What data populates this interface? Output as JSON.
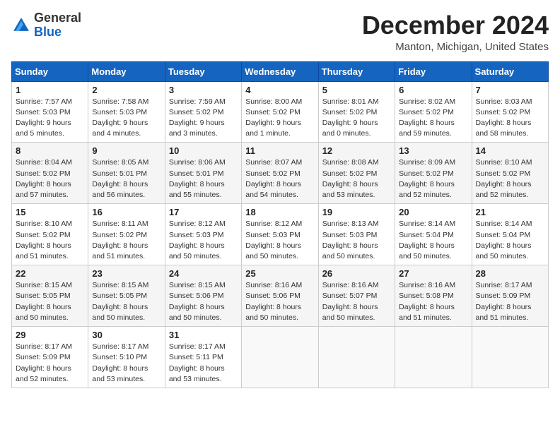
{
  "header": {
    "logo_general": "General",
    "logo_blue": "Blue",
    "month_title": "December 2024",
    "location": "Manton, Michigan, United States"
  },
  "days_of_week": [
    "Sunday",
    "Monday",
    "Tuesday",
    "Wednesday",
    "Thursday",
    "Friday",
    "Saturday"
  ],
  "weeks": [
    [
      {
        "day": 1,
        "sunrise": "Sunrise: 7:57 AM",
        "sunset": "Sunset: 5:03 PM",
        "daylight": "Daylight: 9 hours and 5 minutes."
      },
      {
        "day": 2,
        "sunrise": "Sunrise: 7:58 AM",
        "sunset": "Sunset: 5:03 PM",
        "daylight": "Daylight: 9 hours and 4 minutes."
      },
      {
        "day": 3,
        "sunrise": "Sunrise: 7:59 AM",
        "sunset": "Sunset: 5:02 PM",
        "daylight": "Daylight: 9 hours and 3 minutes."
      },
      {
        "day": 4,
        "sunrise": "Sunrise: 8:00 AM",
        "sunset": "Sunset: 5:02 PM",
        "daylight": "Daylight: 9 hours and 1 minute."
      },
      {
        "day": 5,
        "sunrise": "Sunrise: 8:01 AM",
        "sunset": "Sunset: 5:02 PM",
        "daylight": "Daylight: 9 hours and 0 minutes."
      },
      {
        "day": 6,
        "sunrise": "Sunrise: 8:02 AM",
        "sunset": "Sunset: 5:02 PM",
        "daylight": "Daylight: 8 hours and 59 minutes."
      },
      {
        "day": 7,
        "sunrise": "Sunrise: 8:03 AM",
        "sunset": "Sunset: 5:02 PM",
        "daylight": "Daylight: 8 hours and 58 minutes."
      }
    ],
    [
      {
        "day": 8,
        "sunrise": "Sunrise: 8:04 AM",
        "sunset": "Sunset: 5:02 PM",
        "daylight": "Daylight: 8 hours and 57 minutes."
      },
      {
        "day": 9,
        "sunrise": "Sunrise: 8:05 AM",
        "sunset": "Sunset: 5:01 PM",
        "daylight": "Daylight: 8 hours and 56 minutes."
      },
      {
        "day": 10,
        "sunrise": "Sunrise: 8:06 AM",
        "sunset": "Sunset: 5:01 PM",
        "daylight": "Daylight: 8 hours and 55 minutes."
      },
      {
        "day": 11,
        "sunrise": "Sunrise: 8:07 AM",
        "sunset": "Sunset: 5:02 PM",
        "daylight": "Daylight: 8 hours and 54 minutes."
      },
      {
        "day": 12,
        "sunrise": "Sunrise: 8:08 AM",
        "sunset": "Sunset: 5:02 PM",
        "daylight": "Daylight: 8 hours and 53 minutes."
      },
      {
        "day": 13,
        "sunrise": "Sunrise: 8:09 AM",
        "sunset": "Sunset: 5:02 PM",
        "daylight": "Daylight: 8 hours and 52 minutes."
      },
      {
        "day": 14,
        "sunrise": "Sunrise: 8:10 AM",
        "sunset": "Sunset: 5:02 PM",
        "daylight": "Daylight: 8 hours and 52 minutes."
      }
    ],
    [
      {
        "day": 15,
        "sunrise": "Sunrise: 8:10 AM",
        "sunset": "Sunset: 5:02 PM",
        "daylight": "Daylight: 8 hours and 51 minutes."
      },
      {
        "day": 16,
        "sunrise": "Sunrise: 8:11 AM",
        "sunset": "Sunset: 5:02 PM",
        "daylight": "Daylight: 8 hours and 51 minutes."
      },
      {
        "day": 17,
        "sunrise": "Sunrise: 8:12 AM",
        "sunset": "Sunset: 5:03 PM",
        "daylight": "Daylight: 8 hours and 50 minutes."
      },
      {
        "day": 18,
        "sunrise": "Sunrise: 8:12 AM",
        "sunset": "Sunset: 5:03 PM",
        "daylight": "Daylight: 8 hours and 50 minutes."
      },
      {
        "day": 19,
        "sunrise": "Sunrise: 8:13 AM",
        "sunset": "Sunset: 5:03 PM",
        "daylight": "Daylight: 8 hours and 50 minutes."
      },
      {
        "day": 20,
        "sunrise": "Sunrise: 8:14 AM",
        "sunset": "Sunset: 5:04 PM",
        "daylight": "Daylight: 8 hours and 50 minutes."
      },
      {
        "day": 21,
        "sunrise": "Sunrise: 8:14 AM",
        "sunset": "Sunset: 5:04 PM",
        "daylight": "Daylight: 8 hours and 50 minutes."
      }
    ],
    [
      {
        "day": 22,
        "sunrise": "Sunrise: 8:15 AM",
        "sunset": "Sunset: 5:05 PM",
        "daylight": "Daylight: 8 hours and 50 minutes."
      },
      {
        "day": 23,
        "sunrise": "Sunrise: 8:15 AM",
        "sunset": "Sunset: 5:05 PM",
        "daylight": "Daylight: 8 hours and 50 minutes."
      },
      {
        "day": 24,
        "sunrise": "Sunrise: 8:15 AM",
        "sunset": "Sunset: 5:06 PM",
        "daylight": "Daylight: 8 hours and 50 minutes."
      },
      {
        "day": 25,
        "sunrise": "Sunrise: 8:16 AM",
        "sunset": "Sunset: 5:06 PM",
        "daylight": "Daylight: 8 hours and 50 minutes."
      },
      {
        "day": 26,
        "sunrise": "Sunrise: 8:16 AM",
        "sunset": "Sunset: 5:07 PM",
        "daylight": "Daylight: 8 hours and 50 minutes."
      },
      {
        "day": 27,
        "sunrise": "Sunrise: 8:16 AM",
        "sunset": "Sunset: 5:08 PM",
        "daylight": "Daylight: 8 hours and 51 minutes."
      },
      {
        "day": 28,
        "sunrise": "Sunrise: 8:17 AM",
        "sunset": "Sunset: 5:09 PM",
        "daylight": "Daylight: 8 hours and 51 minutes."
      }
    ],
    [
      {
        "day": 29,
        "sunrise": "Sunrise: 8:17 AM",
        "sunset": "Sunset: 5:09 PM",
        "daylight": "Daylight: 8 hours and 52 minutes."
      },
      {
        "day": 30,
        "sunrise": "Sunrise: 8:17 AM",
        "sunset": "Sunset: 5:10 PM",
        "daylight": "Daylight: 8 hours and 53 minutes."
      },
      {
        "day": 31,
        "sunrise": "Sunrise: 8:17 AM",
        "sunset": "Sunset: 5:11 PM",
        "daylight": "Daylight: 8 hours and 53 minutes."
      },
      null,
      null,
      null,
      null
    ]
  ]
}
